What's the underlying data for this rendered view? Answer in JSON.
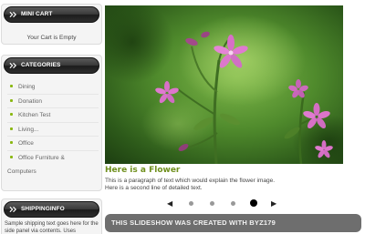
{
  "sidebar": {
    "mini_cart": {
      "title": "MINI CART",
      "icon": "chevron-icon",
      "text": "Your Cart is Empty"
    },
    "categories": {
      "title": "CATEGORIES",
      "icon": "chevron-icon",
      "items": [
        {
          "label": "Dining"
        },
        {
          "label": "Donation"
        },
        {
          "label": "Kitchen Test"
        },
        {
          "label": "Living..."
        },
        {
          "label": "Office"
        },
        {
          "label": "Office Furniture &",
          "label2": "Computers"
        }
      ]
    },
    "shipping": {
      "title": "SHIPPINGINFO",
      "icon": "chevron-icon",
      "text": "Sample shipping text goes here for the side panel via contents. Uses"
    }
  },
  "slideshow": {
    "image_alt": "flower-photo",
    "caption_title": "Here is a Flower",
    "caption_line1": "This is a paragraph of text which would explain the flower image.",
    "caption_line2": "Here is a second line of detailed text.",
    "prev_label": "◀",
    "next_label": "▶",
    "dot_count": 4,
    "active_dot": 4,
    "banner_text": "THIS SLIDESHOW WAS CREATED WITH BYZ179"
  },
  "colors": {
    "accent_green": "#8ab812",
    "title_green": "#6f8f1c",
    "banner_gray": "#6e6e6e",
    "header_black": "#2a2a2a"
  }
}
